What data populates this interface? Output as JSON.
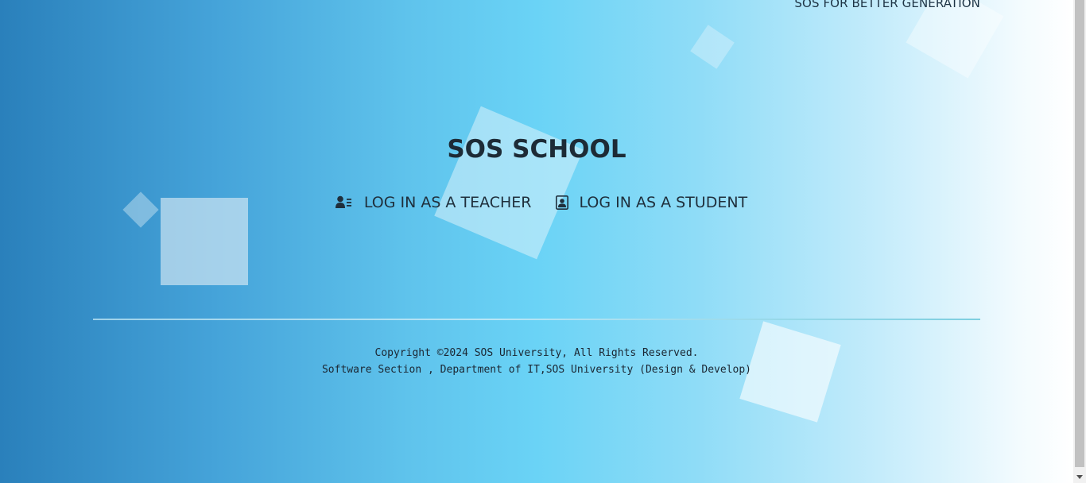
{
  "header": {
    "tagline": "SOS FOR BETTER GENERATION"
  },
  "main": {
    "title": "SOS SCHOOL",
    "teacher_login": {
      "label": "LOG IN AS A TEACHER",
      "icon": "user-list-icon"
    },
    "student_login": {
      "label": "LOG IN AS A STUDENT",
      "icon": "id-card-icon"
    }
  },
  "footer": {
    "copyright": "Copyright ©2024 SOS University, All Rights Reserved.",
    "credits": "Software Section , Department of IT,SOS University (Design & Develop)"
  },
  "colors": {
    "gradient_start": "#2a80bb",
    "gradient_mid": "#6ad3f6",
    "gradient_end": "#ffffff",
    "text": "#1d2b36"
  }
}
